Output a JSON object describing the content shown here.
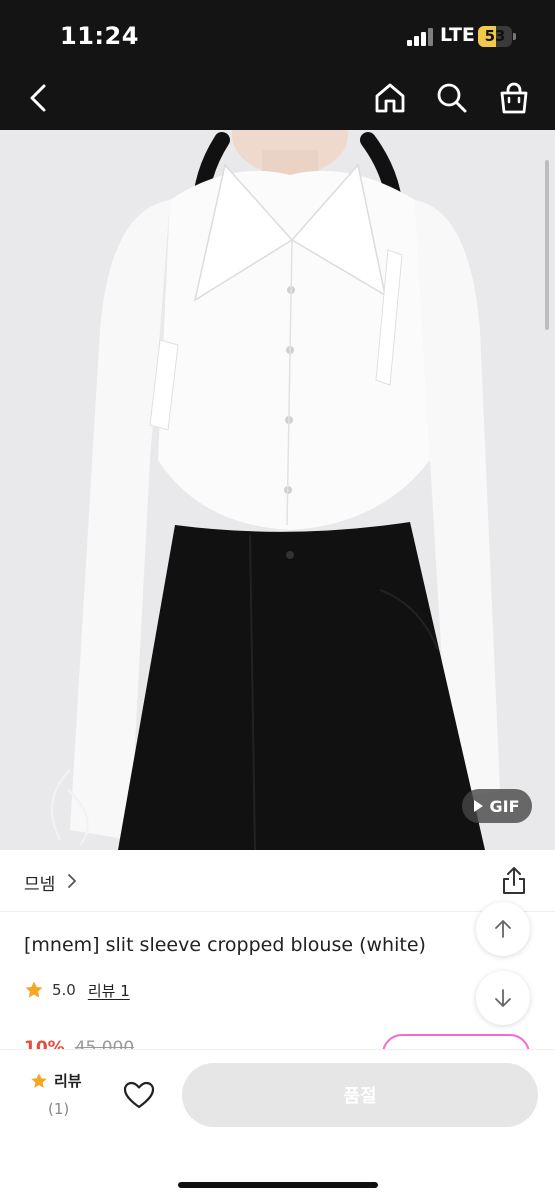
{
  "status_bar": {
    "time": "11:24",
    "network": "LTE",
    "battery": "53",
    "battery_level_percent": 53
  },
  "nav": {
    "back_icon": "chevron-left-icon",
    "home_icon": "home-icon",
    "search_icon": "search-icon",
    "cart_icon": "shopping-bag-icon"
  },
  "image": {
    "gif_badge": "GIF",
    "play_icon": "play-icon"
  },
  "product": {
    "brand": "므넴",
    "title": "[mnem] slit sleeve cropped blouse (white)",
    "rating": "5.0",
    "review_link": "리뷰 1",
    "discount": "10%",
    "original_price": "45,000"
  },
  "bottom_bar": {
    "review_label": "리뷰",
    "review_count": "(1)",
    "soldout_label": "품절"
  },
  "colors": {
    "header_bg": "#141414",
    "star": "#f5a623",
    "discount": "#e74c3c",
    "coupon_border": "#f06ad8",
    "soldout_bg": "#e6e6e6",
    "battery_fill": "#f2c94c"
  }
}
